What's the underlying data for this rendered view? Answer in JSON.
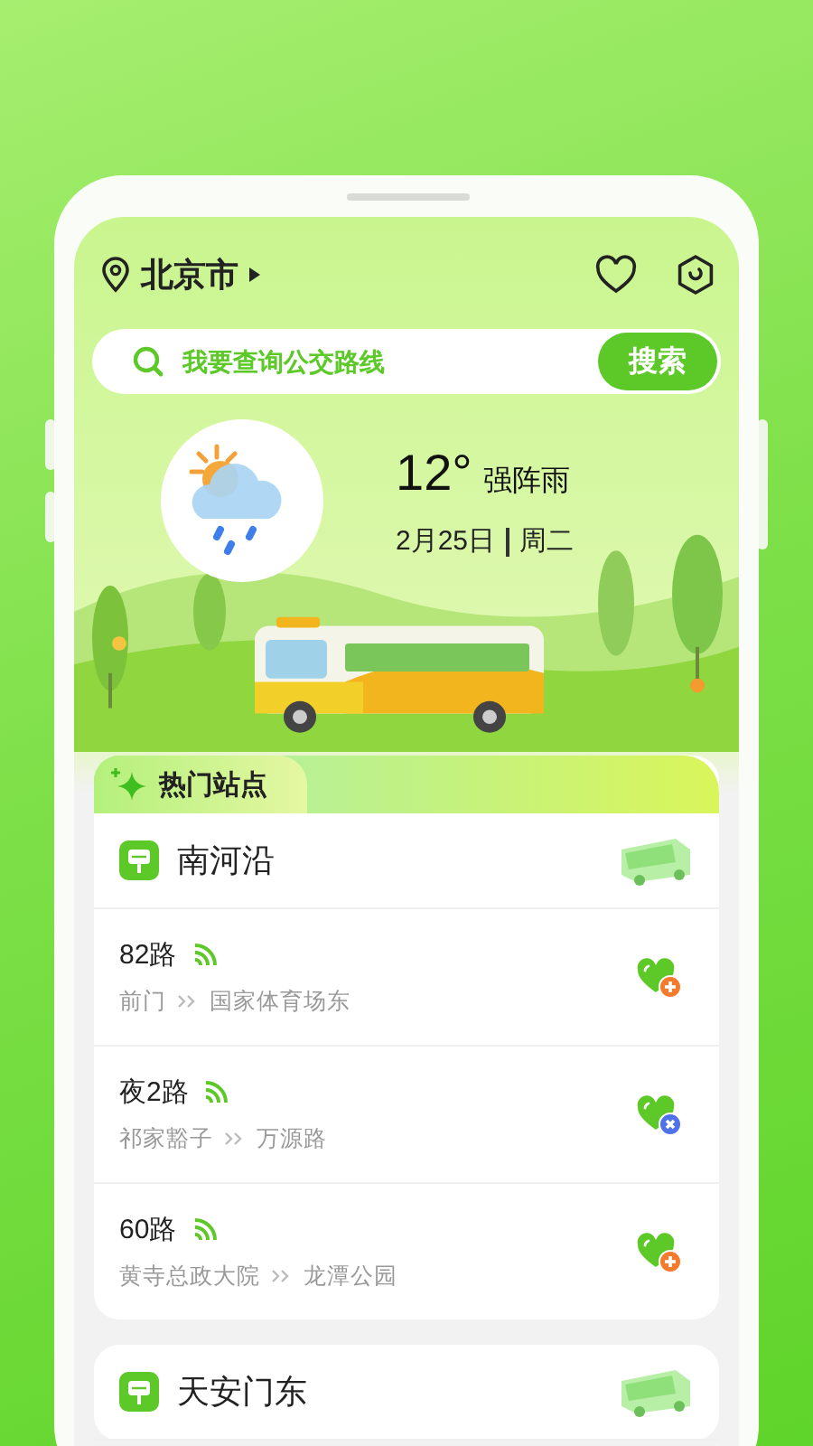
{
  "location": {
    "city": "北京市"
  },
  "search": {
    "placeholder": "我要查询公交路线",
    "button": "搜索"
  },
  "weather": {
    "temperature": "12°",
    "condition": "强阵雨",
    "date": "2月25日",
    "weekday": "周二"
  },
  "section_tab": "热门站点",
  "stations": [
    {
      "name": "南河沿",
      "lines": [
        {
          "route": "82路",
          "from": "前门",
          "to": "国家体育场东",
          "kind": "add"
        },
        {
          "route": "夜2路",
          "from": "祁家豁子",
          "to": "万源路",
          "kind": "remove"
        },
        {
          "route": "60路",
          "from": "黄寺总政大院",
          "to": "龙潭公园",
          "kind": "add"
        }
      ]
    },
    {
      "name": "天安门东"
    }
  ]
}
